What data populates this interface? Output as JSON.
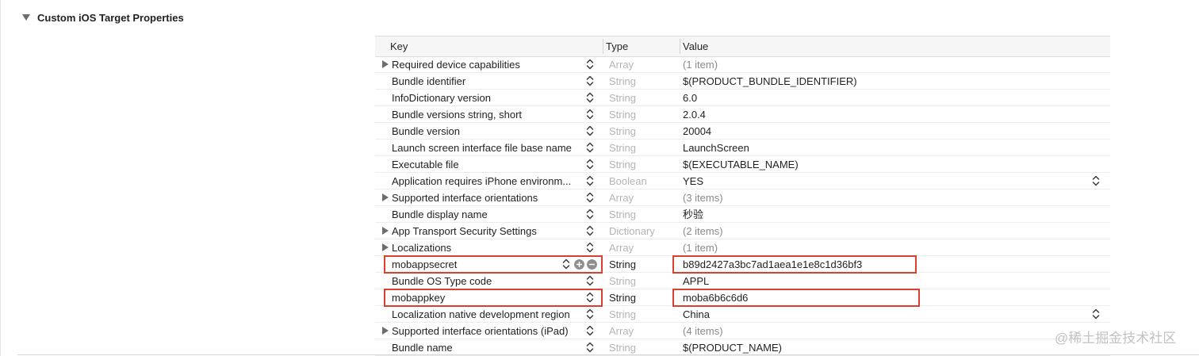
{
  "section": {
    "title": "Custom iOS Target Properties",
    "expanded": true
  },
  "columns": {
    "key": "Key",
    "type": "Type",
    "value": "Value"
  },
  "rows": [
    {
      "key": "Required device capabilities",
      "type": "Array",
      "value": "(1 item)",
      "expandable": true
    },
    {
      "key": "Bundle identifier",
      "type": "String",
      "value": "$(PRODUCT_BUNDLE_IDENTIFIER)",
      "expandable": false
    },
    {
      "key": "InfoDictionary version",
      "type": "String",
      "value": "6.0",
      "expandable": false
    },
    {
      "key": "Bundle versions string, short",
      "type": "String",
      "value": "2.0.4",
      "expandable": false
    },
    {
      "key": "Bundle version",
      "type": "String",
      "value": "20004",
      "expandable": false
    },
    {
      "key": "Launch screen interface file base name",
      "type": "String",
      "value": "LaunchScreen",
      "expandable": false
    },
    {
      "key": "Executable file",
      "type": "String",
      "value": "$(EXECUTABLE_NAME)",
      "expandable": false
    },
    {
      "key": "Application requires iPhone environm...",
      "type": "Boolean",
      "value": "YES",
      "expandable": false,
      "value_popup": true
    },
    {
      "key": "Supported interface orientations",
      "type": "Array",
      "value": "(3 items)",
      "expandable": true
    },
    {
      "key": "Bundle display name",
      "type": "String",
      "value": "秒验",
      "expandable": false
    },
    {
      "key": "App Transport Security Settings",
      "type": "Dictionary",
      "value": "(2 items)",
      "expandable": true
    },
    {
      "key": "Localizations",
      "type": "Array",
      "value": "(1 item)",
      "expandable": true
    },
    {
      "key": "mobappsecret",
      "type": "String",
      "value": "b89d2427a3bc7ad1aea1e1e8c1d36bf3",
      "expandable": false,
      "selected": true,
      "highlighted": true
    },
    {
      "key": "Bundle OS Type code",
      "type": "String",
      "value": "APPL",
      "expandable": false
    },
    {
      "key": "mobappkey",
      "type": "String",
      "value": "moba6b6c6d6",
      "expandable": false,
      "highlighted": true
    },
    {
      "key": "Localization native development region",
      "type": "String",
      "value": "China",
      "expandable": false,
      "value_popup": true
    },
    {
      "key": "Supported interface orientations (iPad)",
      "type": "Array",
      "value": "(4 items)",
      "expandable": true
    },
    {
      "key": "Bundle name",
      "type": "String",
      "value": "$(PRODUCT_NAME)",
      "expandable": false
    }
  ],
  "watermark": "@稀土掘金技术社区",
  "colors": {
    "highlight": "#d9412e",
    "dim_type": "#b4b4b4",
    "dim_value": "#8a8a8a"
  }
}
